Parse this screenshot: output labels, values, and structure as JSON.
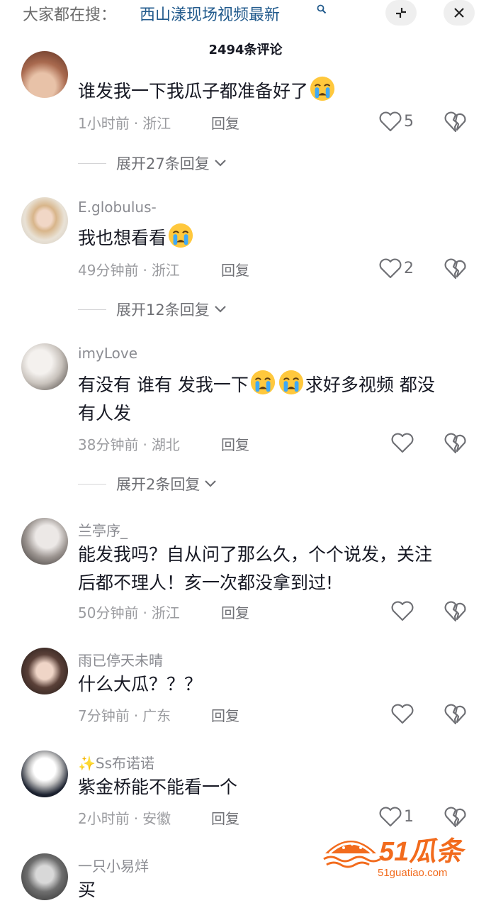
{
  "search": {
    "prefix": "大家都在搜：",
    "term": "西山漾现场视频最新"
  },
  "comments_title": "2494条评论",
  "reply_label": "回复",
  "comments": [
    {
      "username": "",
      "text_parts": [
        "谁发我一下我瓜子都准备好了"
      ],
      "emoji_count": 1,
      "time": "1小时前",
      "region": "浙江",
      "likes": "5",
      "expand": "展开27条回复"
    },
    {
      "username": "E.globulus-",
      "text_parts": [
        "我也想看看"
      ],
      "emoji_count": 1,
      "time": "49分钟前",
      "region": "浙江",
      "likes": "2",
      "expand": "展开12条回复"
    },
    {
      "username": "imyLove",
      "text_line1_a": "有没有 谁有 发我一下",
      "text_line1_b": "求好多视频 都没",
      "text_line2": "有人发",
      "time": "38分钟前",
      "region": "湖北",
      "likes": "",
      "expand": "展开2条回复"
    },
    {
      "username": "兰亭序_",
      "text_line1": "能发我吗？自从问了那么久，个个说发，关注",
      "text_line2": "后都不理人！亥一次都没拿到过!",
      "time": "50分钟前",
      "region": "浙江",
      "likes": ""
    },
    {
      "username": "雨已停天未晴",
      "text_line1": "什么大瓜？？？",
      "time": "7分钟前",
      "region": "广东",
      "likes": ""
    },
    {
      "username": "✨Ss布诺诺",
      "text_line1": "紫金桥能不能看一个",
      "time": "2小时前",
      "region": "安徽",
      "likes": "1"
    },
    {
      "username": "一只小易烊",
      "text_line1": "买"
    }
  ],
  "watermark": {
    "brand": "51瓜条",
    "url": "51guatiao.com"
  },
  "colors": {
    "search_term": "#215a8c",
    "watermark": "#f26b1d"
  },
  "icons": [
    "search-icon",
    "collapse-icon",
    "close-icon",
    "heart-icon",
    "broken-heart-icon",
    "chevron-down-icon",
    "crying-emoji"
  ]
}
